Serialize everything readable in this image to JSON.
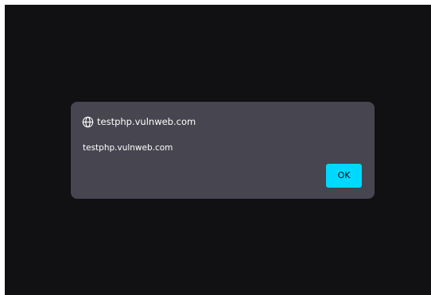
{
  "dialog": {
    "title": "testphp.vulnweb.com",
    "message": "testphp.vulnweb.com",
    "ok_label": "OK",
    "icon": "globe-icon"
  },
  "colors": {
    "backdrop": "#111013",
    "dialog_bg": "#47454f",
    "text": "#ffffff",
    "accent": "#00d9ff"
  }
}
